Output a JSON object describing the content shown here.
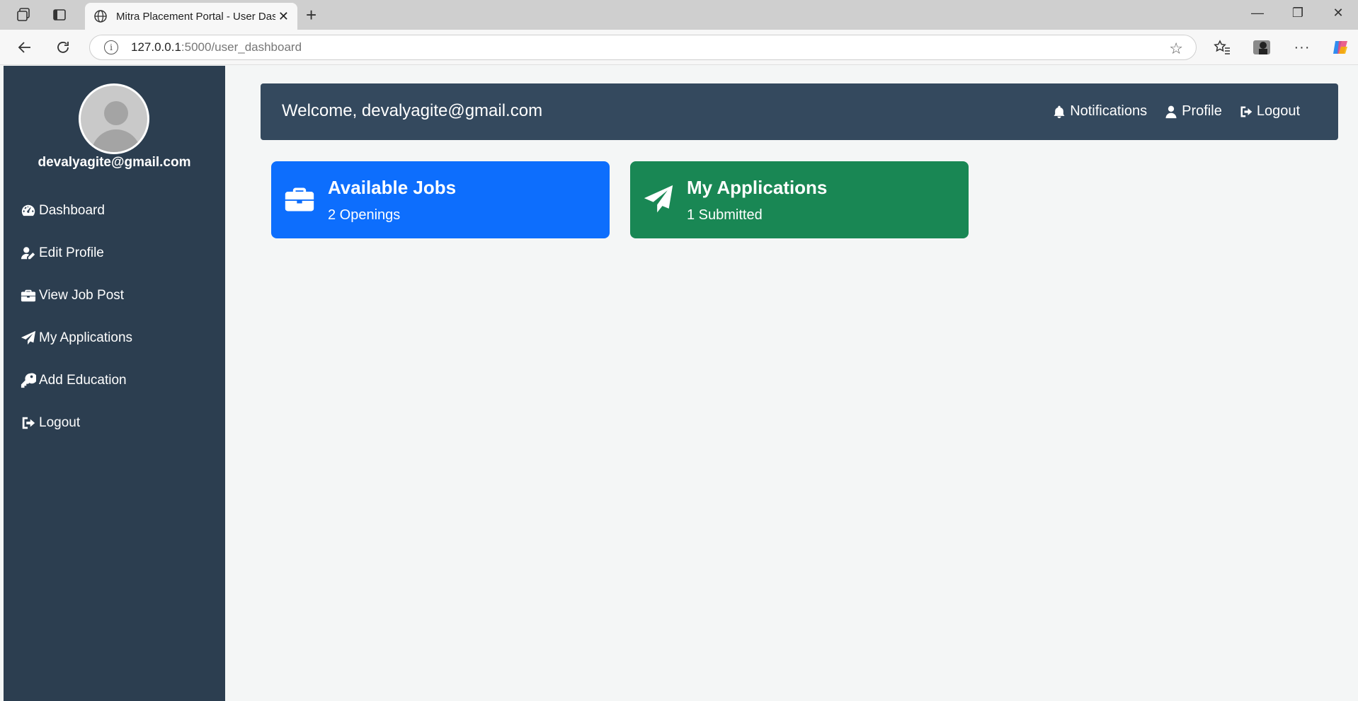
{
  "browser": {
    "tab_title": "Mitra Placement Portal - User Dashboard",
    "url_host": "127.0.0.1",
    "url_path": ":5000/user_dashboard"
  },
  "sidebar": {
    "user_email": "devalyagite@gmail.com",
    "items": [
      {
        "label": "Dashboard",
        "icon": "gauge-icon"
      },
      {
        "label": "Edit Profile",
        "icon": "user-edit-icon"
      },
      {
        "label": "View Job Post",
        "icon": "briefcase-icon"
      },
      {
        "label": "My Applications",
        "icon": "paper-plane-icon"
      },
      {
        "label": "Add Education",
        "icon": "key-icon"
      },
      {
        "label": "Logout",
        "icon": "sign-out-icon"
      }
    ]
  },
  "header": {
    "welcome": "Welcome, devalyagite@gmail.com",
    "links": [
      {
        "label": "Notifications",
        "icon": "bell-icon"
      },
      {
        "label": "Profile",
        "icon": "user-icon"
      },
      {
        "label": "Logout",
        "icon": "sign-out-icon"
      }
    ]
  },
  "cards": [
    {
      "title": "Available Jobs",
      "subtitle": "2 Openings",
      "color": "#0d6efd",
      "icon": "briefcase-icon"
    },
    {
      "title": "My Applications",
      "subtitle": "1 Submitted",
      "color": "#198754",
      "icon": "paper-plane-icon"
    }
  ],
  "colors": {
    "sidebar_bg": "#2c3e50",
    "header_bg": "#34495e",
    "page_bg": "#f4f6f6"
  }
}
